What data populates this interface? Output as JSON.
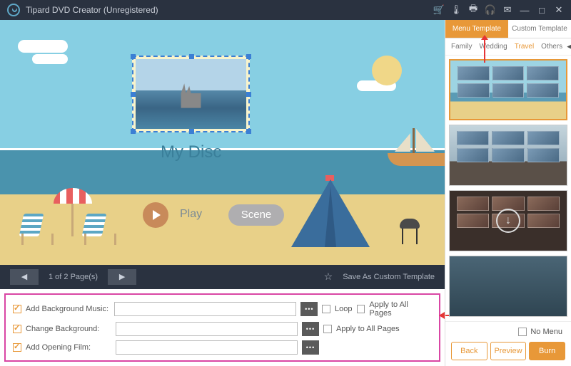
{
  "titlebar": {
    "title": "Tipard DVD Creator (Unregistered)"
  },
  "preview": {
    "disc_title": "My Disc",
    "play_label": "Play",
    "scene_label": "Scene"
  },
  "pager": {
    "text": "1 of 2 Page(s)",
    "save_template": "Save As Custom Template"
  },
  "options": {
    "bg_music": {
      "label": "Add Background Music:",
      "checked": true,
      "loop_label": "Loop",
      "apply_label": "Apply to All Pages"
    },
    "change_bg": {
      "label": "Change Background:",
      "checked": true,
      "apply_label": "Apply to All Pages"
    },
    "opening_film": {
      "label": "Add Opening Film:",
      "checked": true
    }
  },
  "template_panel": {
    "tabs": {
      "menu": "Menu Template",
      "custom": "Custom Template"
    },
    "categories": [
      "Family",
      "Wedding",
      "Travel",
      "Others"
    ],
    "active_category": "Travel",
    "no_menu": "No Menu"
  },
  "buttons": {
    "back": "Back",
    "preview": "Preview",
    "burn": "Burn"
  }
}
